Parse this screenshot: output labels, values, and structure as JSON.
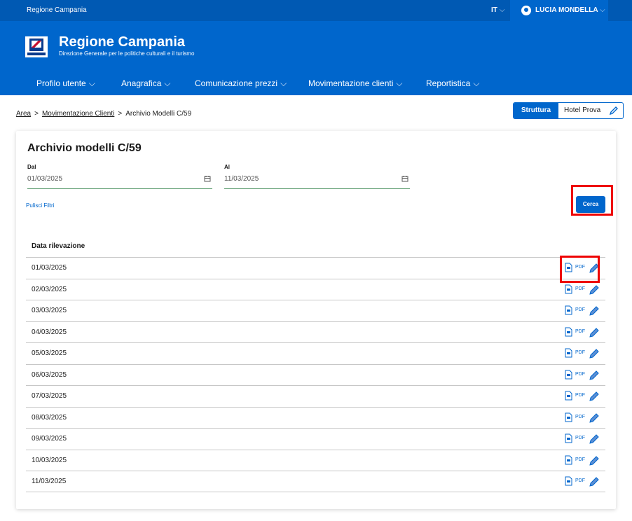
{
  "topbar": {
    "org": "Regione Campania",
    "lang": "IT",
    "user": "LUCIA MONDELLA"
  },
  "header": {
    "title": "Regione Campania",
    "subtitle": "Direzione Generale per le politiche culturali e il turismo"
  },
  "nav": [
    {
      "label": "Profilo utente"
    },
    {
      "label": "Anagrafica"
    },
    {
      "label": "Comunicazione prezzi"
    },
    {
      "label": "Movimentazione clienti"
    },
    {
      "label": "Reportistica"
    }
  ],
  "breadcrumb": {
    "area": "Area",
    "sep": ">",
    "section": "Movimentazione Clienti",
    "current": "Archivio Modelli C/59"
  },
  "struttura": {
    "label": "Struttura",
    "value": "Hotel Prova"
  },
  "card": {
    "title": "Archivio modelli C/59",
    "dal": {
      "label": "Dal",
      "value": "01/03/2025"
    },
    "al": {
      "label": "Al",
      "value": "11/03/2025"
    },
    "clear_filters": "Pulisci Filtri",
    "search": "Cerca",
    "column": "Data rilevazione",
    "pdf_label": "PDF",
    "rows": [
      "01/03/2025",
      "02/03/2025",
      "03/03/2025",
      "04/03/2025",
      "05/03/2025",
      "06/03/2025",
      "07/03/2025",
      "08/03/2025",
      "09/03/2025",
      "10/03/2025",
      "11/03/2025"
    ]
  },
  "colors": {
    "primary": "#0066cc",
    "dark": "#0059b3",
    "highlight": "#e00000"
  }
}
